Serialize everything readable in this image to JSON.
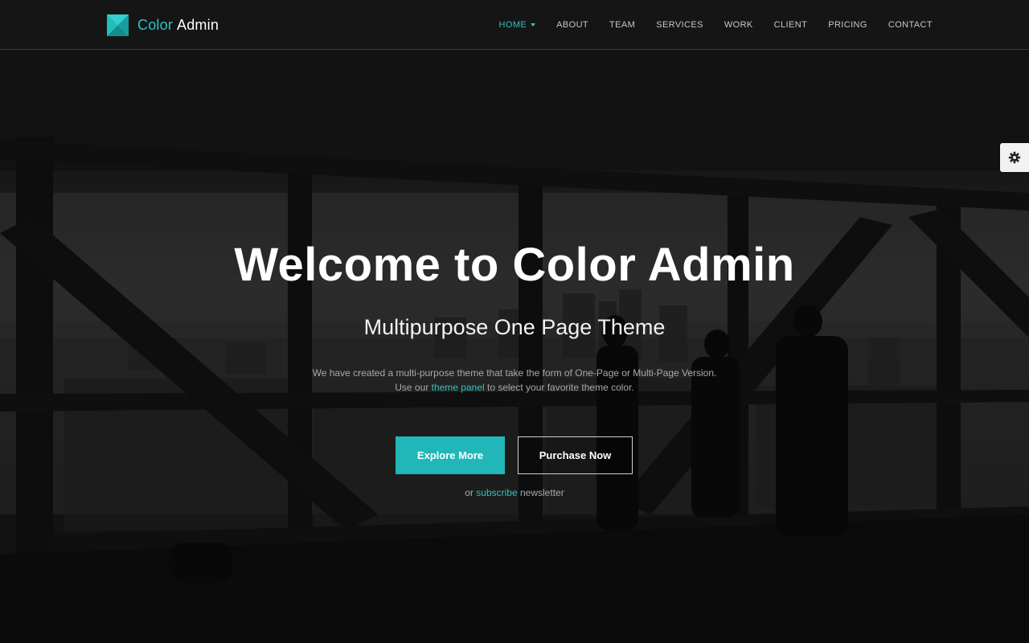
{
  "brand": {
    "name_first": "Color",
    "name_second": "Admin",
    "logo_icon": "color-admin-logo",
    "accent_color": "#2ec4c4"
  },
  "nav": {
    "items": [
      {
        "label": "HOME",
        "active": true,
        "has_caret": true
      },
      {
        "label": "ABOUT"
      },
      {
        "label": "TEAM"
      },
      {
        "label": "SERVICES"
      },
      {
        "label": "WORK"
      },
      {
        "label": "CLIENT"
      },
      {
        "label": "PRICING"
      },
      {
        "label": "CONTACT"
      }
    ]
  },
  "theme_panel": {
    "icon": "gear-icon"
  },
  "hero": {
    "title": "Welcome to Color Admin",
    "subtitle": "Multipurpose One Page Theme",
    "description_line1": "We have created a multi-purpose theme that take the form of One-Page or Multi-Page Version.",
    "description_line2_before": "Use our",
    "description_line2_link": "theme panel",
    "description_line2_after": "to select your favorite theme color.",
    "primary_button": "Explore More",
    "secondary_button": "Purchase Now",
    "subscribe_before": "or",
    "subscribe_link": "subscribe",
    "subscribe_after": "newsletter"
  },
  "colors": {
    "primary_button_bg": "#21b7b8",
    "link": "#2ec4c4"
  }
}
